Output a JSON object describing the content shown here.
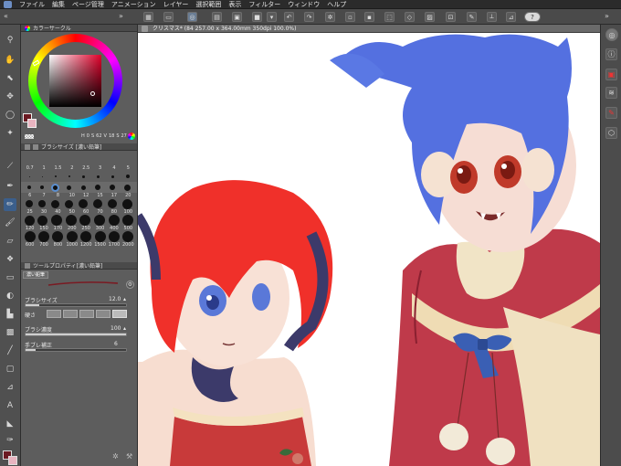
{
  "menu": {
    "items": [
      "ファイル",
      "編集",
      "ページ管理",
      "アニメーション",
      "レイヤー",
      "選択範囲",
      "表示",
      "フィルター",
      "ウィンドウ",
      "ヘルプ"
    ]
  },
  "color_panel": {
    "title": "カラーサークル",
    "readout": [
      "H",
      "0",
      "S",
      "62",
      "V",
      "18",
      "S",
      "27"
    ],
    "colors": {
      "main": "#6b1a22",
      "sub": "#e8b4c0"
    }
  },
  "brush_size_panel": {
    "title": "ブラシサイズ [濃い鉛筆]",
    "row1": [
      "0.7",
      "1",
      "1.5",
      "2",
      "2.5",
      "3",
      "4",
      "5"
    ],
    "row2": [
      "6",
      "7",
      "8",
      "10",
      "12",
      "15",
      "17",
      "20"
    ],
    "row3": [
      "25",
      "30",
      "40",
      "50",
      "60",
      "70",
      "80",
      "100"
    ],
    "row4": [
      "120",
      "150",
      "170",
      "200",
      "250",
      "300",
      "400",
      "500"
    ],
    "row5": [
      "600",
      "700",
      "800",
      "1000",
      "1200",
      "1500",
      "1700",
      "2000"
    ]
  },
  "tool_property": {
    "title": "ツールプロパティ[濃い鉛筆]",
    "tab": "濃い鉛筆",
    "brush_size_label": "ブラシサイズ",
    "brush_size_value": "12.0",
    "hardness_label": "硬さ",
    "density_label": "ブラシ濃度",
    "density_value": "100",
    "stabilization_label": "手ブレ補正",
    "stabilization_value": "6",
    "brush_size_level": 0.14,
    "density_level": 1.0,
    "stabilization_level": 0.1
  },
  "canvas": {
    "tab_title": "クリスマス* (84 257.00 x 364.00mm 350dpi 100.0%)"
  },
  "icons": {
    "help": "?"
  }
}
